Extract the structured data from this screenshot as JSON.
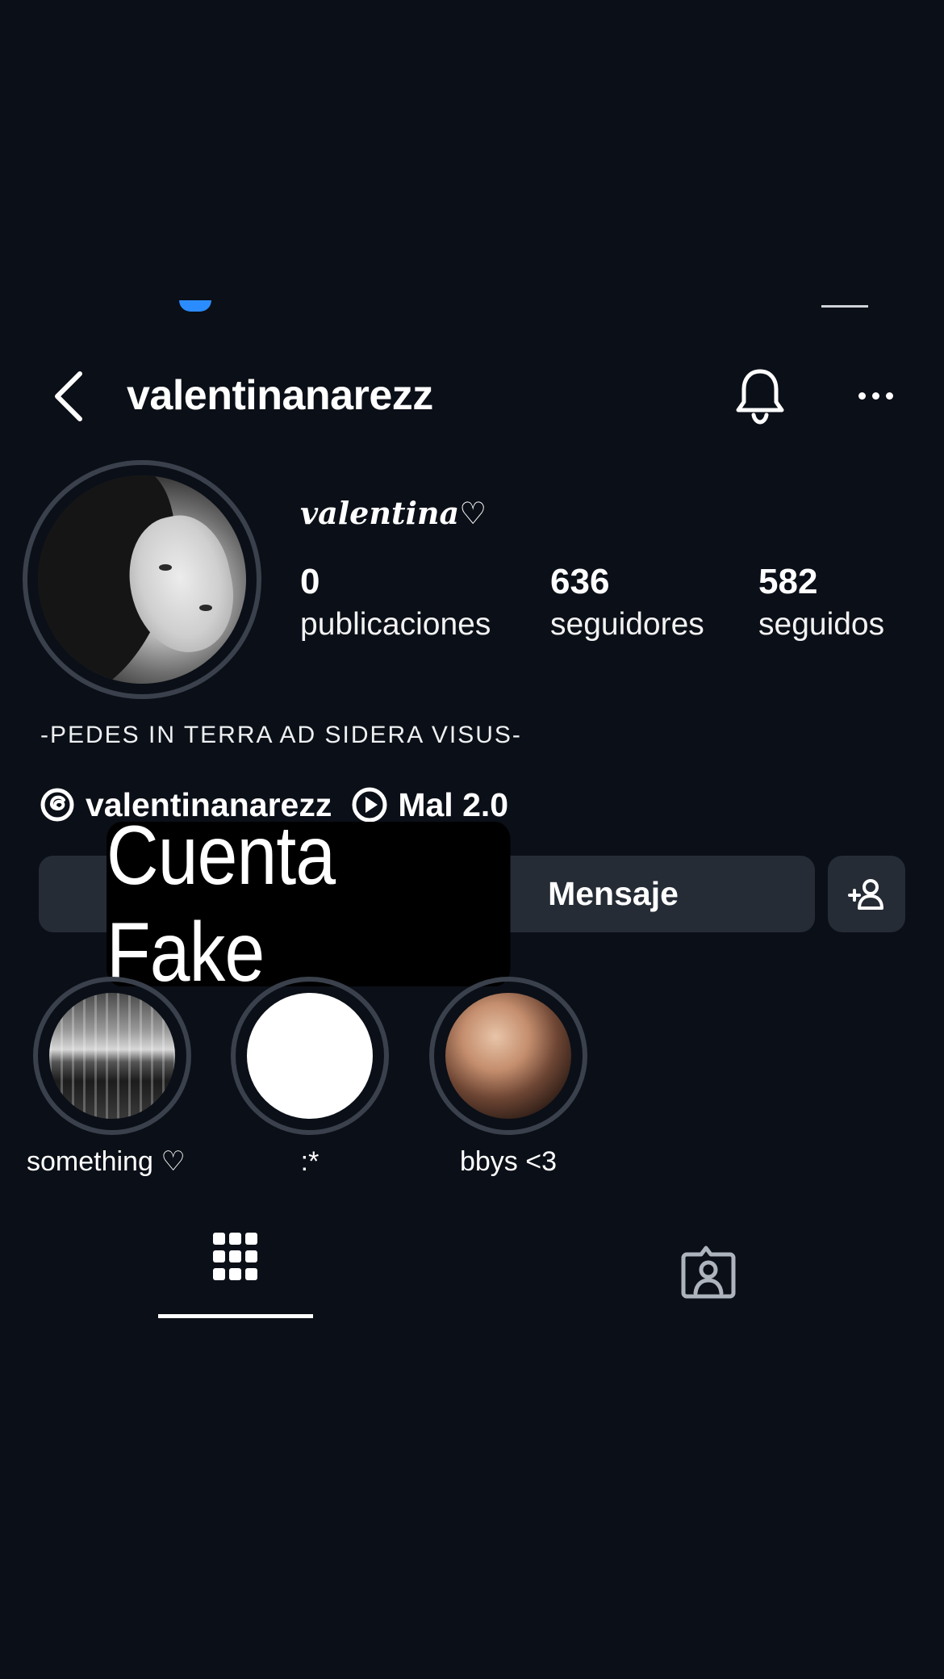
{
  "header": {
    "back_icon": "chevron-left-icon",
    "username": "valentinanarezz",
    "bell_icon": "bell-icon",
    "more_icon": "more-horizontal-icon"
  },
  "profile": {
    "display_name": "valentina♡",
    "stats": [
      {
        "value": "0",
        "label": "publicaciones"
      },
      {
        "value": "636",
        "label": "seguidores"
      },
      {
        "value": "582",
        "label": "seguidos"
      }
    ],
    "bio": "-PEDES IN TERRA AD SIDERA VISUS-",
    "threads_handle": "valentinanarezz",
    "music": "Mal 2.0"
  },
  "actions": {
    "follow_label": "",
    "message_label": "Mensaje",
    "add_person_icon": "add-person-icon"
  },
  "sticker": {
    "text": "Cuenta Fake"
  },
  "highlights": [
    {
      "label": "something ♡"
    },
    {
      "label": ":*"
    },
    {
      "label": "bbys <3"
    }
  ],
  "tabs": {
    "grid_icon": "grid-icon",
    "tagged_icon": "tagged-person-icon"
  },
  "colors": {
    "background": "#0b0f17",
    "button": "#262c35",
    "ring": "#3b414c",
    "accent_blue": "#2b8cff"
  }
}
